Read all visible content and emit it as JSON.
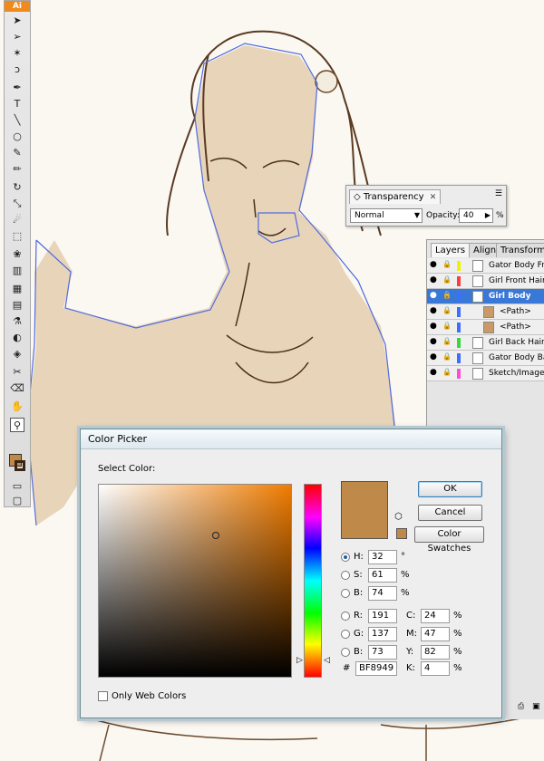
{
  "app": {
    "logo": "Ai"
  },
  "toolbar": {
    "tools": [
      "selection-tool",
      "direct-selection-tool",
      "magic-wand-tool",
      "lasso-tool",
      "pen-tool",
      "type-tool",
      "line-tool",
      "ellipse-tool",
      "paintbrush-tool",
      "pencil-tool",
      "rotate-tool",
      "scale-tool",
      "warp-tool",
      "free-transform-tool",
      "symbol-sprayer-tool",
      "column-graph-tool",
      "mesh-tool",
      "gradient-tool",
      "eyedropper-tool",
      "blend-tool",
      "live-paint-tool",
      "slice-tool",
      "eraser-tool",
      "hand-tool",
      "zoom-tool"
    ],
    "fill_color": "#BF8949",
    "stroke_color": "#3a2414"
  },
  "transparency": {
    "tab_label": "Transparency",
    "blend_mode": "Normal",
    "opacity_label": "Opacity:",
    "opacity_value": "40",
    "opacity_unit": "%"
  },
  "layers_panel": {
    "tabs": [
      "Layers",
      "Align",
      "Transform"
    ],
    "rows": [
      {
        "name": "Gator Body Front",
        "color": "#f2f200",
        "selected": false,
        "indent": false
      },
      {
        "name": "Girl Front Hair",
        "color": "#ff3b3b",
        "selected": false,
        "indent": false
      },
      {
        "name": "Girl Body",
        "color": "#3b6fff",
        "selected": true,
        "indent": false
      },
      {
        "name": "<Path>",
        "color": "#3b6fff",
        "selected": false,
        "indent": true
      },
      {
        "name": "<Path>",
        "color": "#3b6fff",
        "selected": false,
        "indent": true
      },
      {
        "name": "Girl Back Hair",
        "color": "#3bd63b",
        "selected": false,
        "indent": false
      },
      {
        "name": "Gator Body Back",
        "color": "#3b6fff",
        "selected": false,
        "indent": false
      },
      {
        "name": "Sketch/Image",
        "color": "#ff4dd2",
        "selected": false,
        "indent": false
      }
    ]
  },
  "color_picker": {
    "title": "Color Picker",
    "select_label": "Select Color:",
    "ok": "OK",
    "cancel": "Cancel",
    "swatches": "Color Swatches",
    "color": "#BF8949",
    "h": "32",
    "s": "61",
    "b": "74",
    "r": "191",
    "g": "137",
    "b2": "73",
    "c": "24",
    "m": "47",
    "y": "82",
    "k": "4",
    "hex": "BF8949",
    "labels": {
      "h": "H:",
      "s": "S:",
      "b": "B:",
      "r": "R:",
      "g": "G:",
      "b2": "B:",
      "c": "C:",
      "m": "M:",
      "y": "Y:",
      "k": "K:",
      "hash": "#"
    },
    "units": {
      "deg": "°",
      "pct": "%"
    },
    "web_only_label": "Only Web Colors"
  }
}
